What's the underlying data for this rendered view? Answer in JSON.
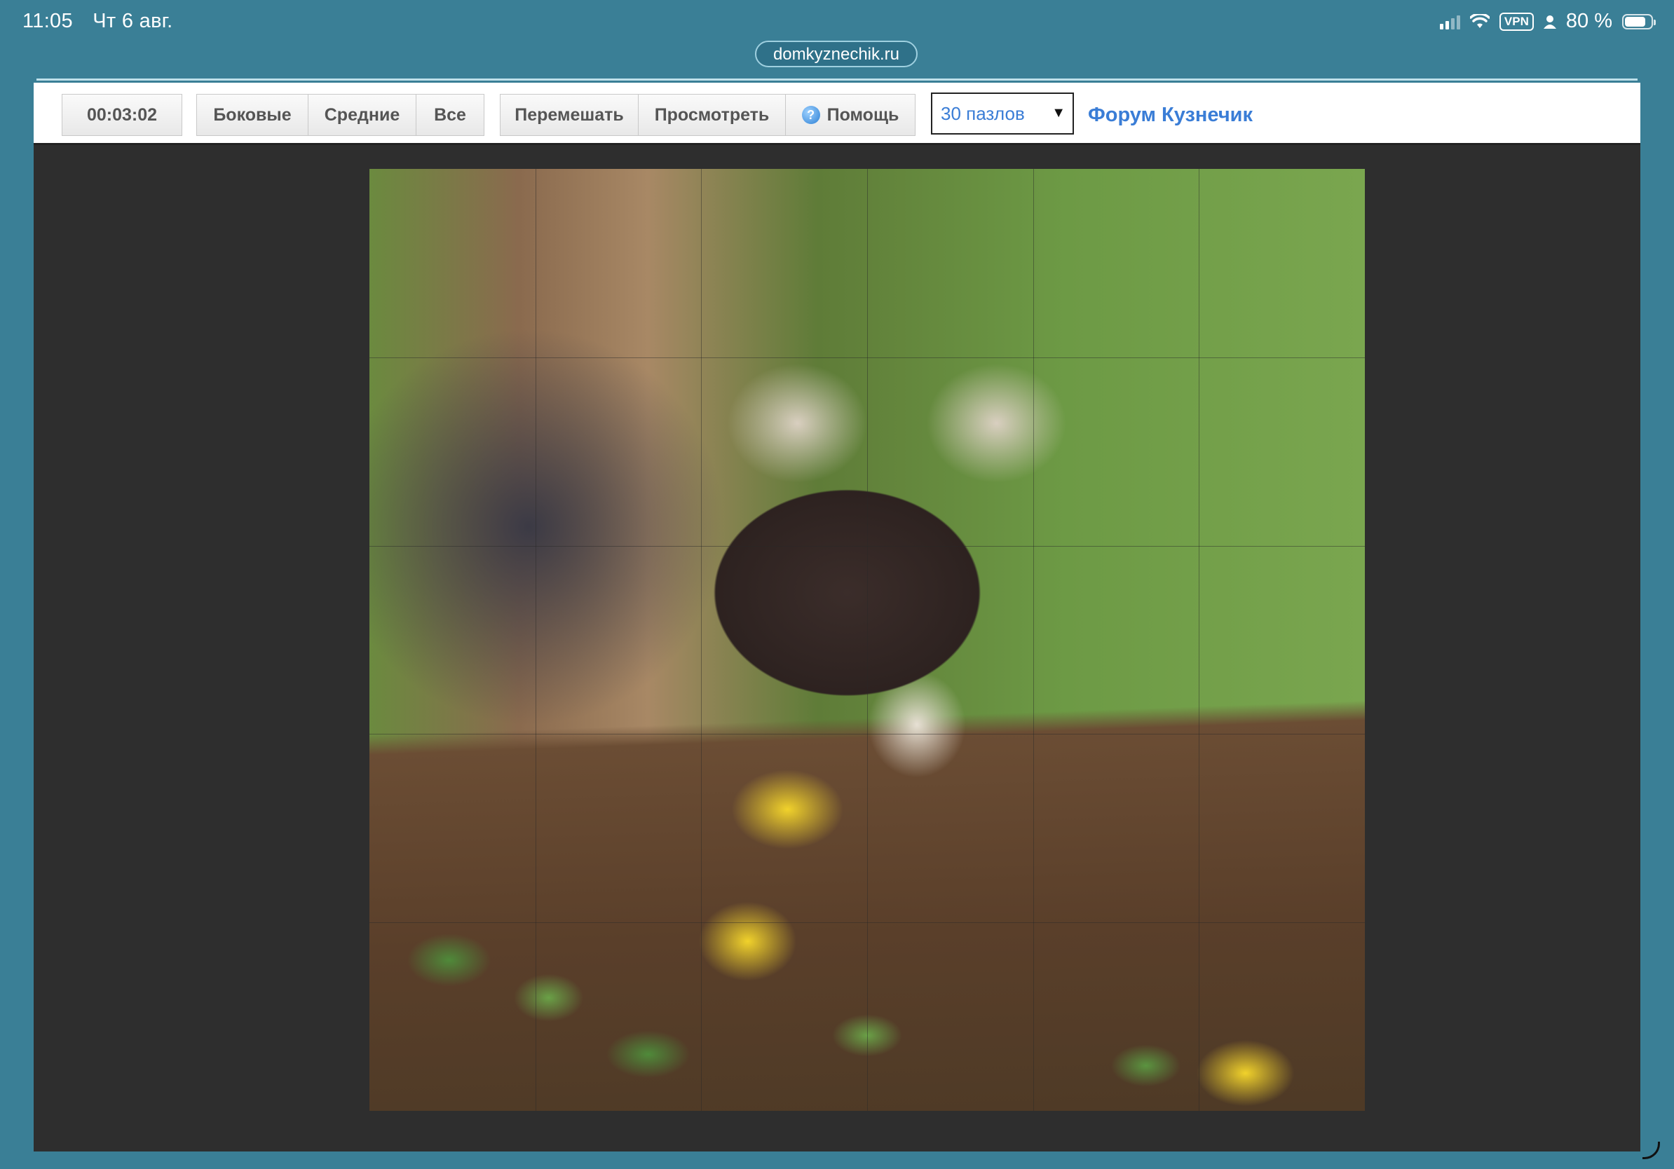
{
  "status": {
    "time": "11:05",
    "date": "Чт 6 авг.",
    "vpn": "VPN",
    "battery_text": "80 %",
    "battery_level": 0.8
  },
  "browser": {
    "url": "domkyznechik.ru"
  },
  "toolbar": {
    "timer": "00:03:02",
    "sides_label": "Боковые",
    "middle_label": "Средние",
    "all_label": "Все",
    "shuffle_label": "Перемешать",
    "preview_label": "Просмотреть",
    "help_label": "Помощь",
    "pieces_select": "30 пазлов",
    "forum_link": "Форум Кузнечик"
  },
  "puzzle": {
    "columns": 6,
    "rows": 5,
    "image_icon": "raccoon-puzzle-image"
  }
}
